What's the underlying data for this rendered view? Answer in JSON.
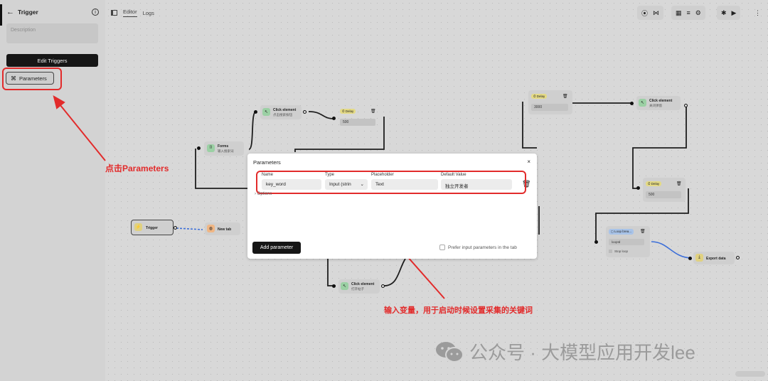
{
  "sidebar": {
    "title": "Trigger",
    "description_placeholder": "Description",
    "edit_triggers_label": "Edit Triggers",
    "parameters_label": "Parameters"
  },
  "editor_tabs": [
    "Editor",
    "Logs"
  ],
  "nodes": {
    "trigger": "Trigger",
    "new_tab": "New tab",
    "forms": "Forms",
    "forms_sub": "输入搜索词",
    "click1": "Click element",
    "click1_sub": "点击搜索按钮",
    "delay_label": "Delay",
    "delay1_value": "500",
    "delay2_value": "3000",
    "delay3_value": "500",
    "click2": "Click element",
    "click2_sub": "关闭弹窗",
    "click3": "Click element",
    "click3_sub": "打开帖子",
    "loop": "Loop brea...",
    "loop_id": "loopId",
    "stop_loop": "Stop loop",
    "export": "Export data"
  },
  "modal": {
    "title": "Parameters",
    "headers": {
      "name": "Name",
      "type": "Type",
      "placeholder": "Placeholder",
      "default": "Default Value"
    },
    "row": {
      "name": "key_word",
      "type": "Input (strin",
      "placeholder": "Text",
      "default": "独立开发者"
    },
    "options_label": "Options",
    "add_button": "Add parameter",
    "prefer_label": "Prefer input parameters in the tab"
  },
  "annotations": {
    "click_params": "点击Parameters",
    "input_var": "输入变量，用于启动时候设置采集的关键词"
  },
  "watermark": "公众号 · 大模型应用开发lee",
  "colors": {
    "annotation_red": "#e22b2b",
    "dark_button": "#161616"
  }
}
